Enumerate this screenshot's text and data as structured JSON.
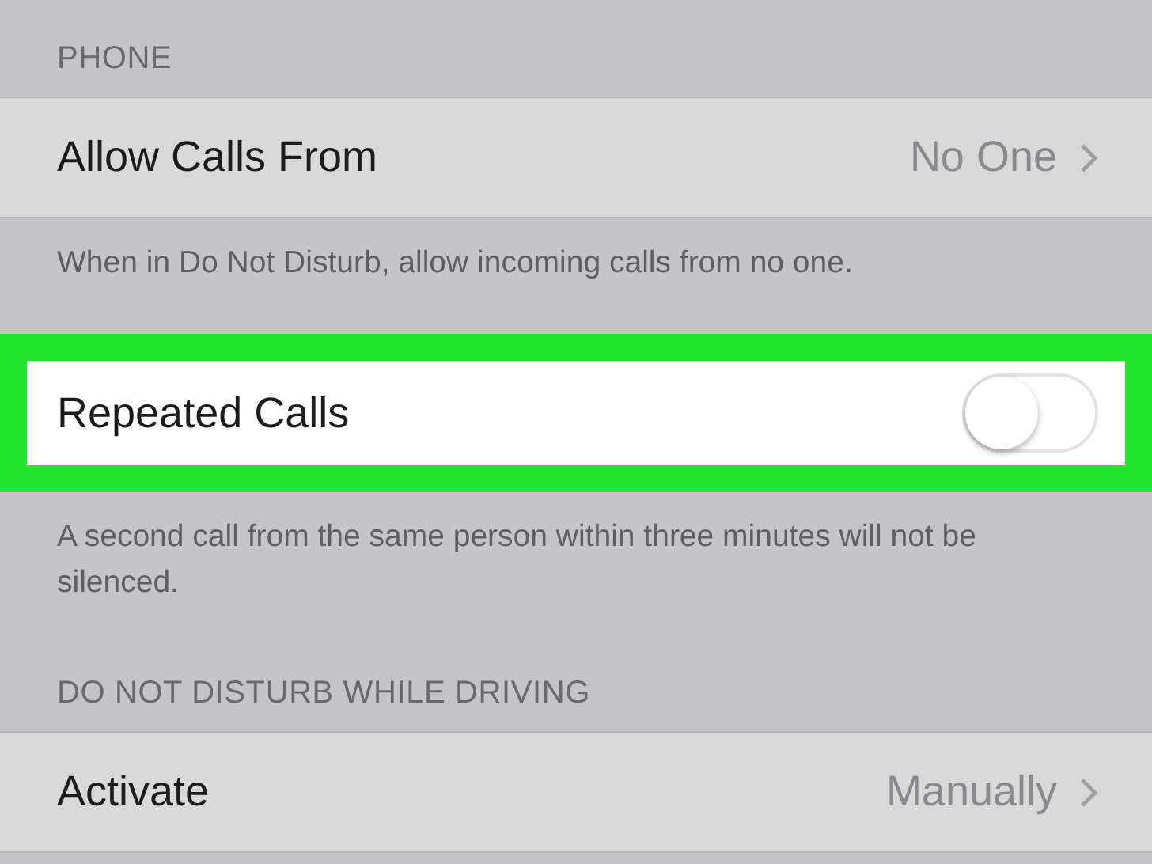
{
  "sections": [
    {
      "header": "PHONE",
      "rows": [
        {
          "kind": "disclosure",
          "title": "Allow Calls From",
          "value": "No One",
          "highlighted": false
        }
      ],
      "footer": "When in Do Not Disturb, allow incoming calls from no one."
    },
    {
      "rows": [
        {
          "kind": "toggle",
          "title": "Repeated Calls",
          "on": false,
          "highlighted": true
        }
      ],
      "footer": "A second call from the same person within three minutes will not be silenced."
    },
    {
      "header": "DO NOT DISTURB WHILE DRIVING",
      "rows": [
        {
          "kind": "disclosure",
          "title": "Activate",
          "value": "Manually",
          "highlighted": false
        }
      ]
    }
  ]
}
